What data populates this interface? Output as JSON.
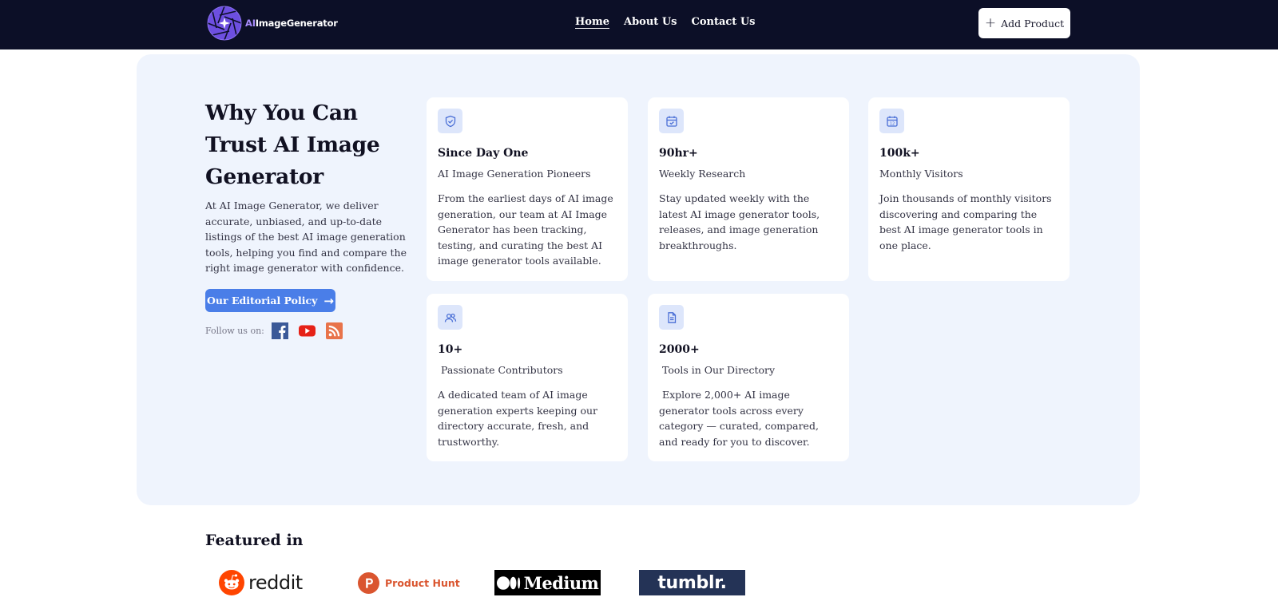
{
  "header": {
    "logo_prefix": "AI",
    "logo_suffix": "ImageGenerator",
    "nav": [
      {
        "label": "Home",
        "active": true
      },
      {
        "label": "About Us",
        "active": false
      },
      {
        "label": "Contact Us",
        "active": false
      }
    ],
    "add_product_label": "Add Product"
  },
  "trust": {
    "title": "Why You Can Trust AI Image Generator",
    "body": "At AI Image Generator, we deliver accurate, unbiased, and up-to-date listings of the best AI image generation tools, helping you find and compare the right image generator with confidence.",
    "policy_button": "Our Editorial Policy",
    "follow_label": "Follow us on:",
    "social": [
      "facebook-icon",
      "youtube-icon",
      "rss-icon"
    ],
    "cards": [
      {
        "icon": "shield-check-icon",
        "stat": "Since Day One",
        "label": "AI Image Generation Pioneers",
        "description": "From the earliest days of AI image generation, our team at AI Image Generator has been tracking, testing, and curating the best AI image generator tools available."
      },
      {
        "icon": "calendar-check-icon",
        "stat": "90hr+",
        "label": "Weekly Research",
        "description": "Stay updated weekly with the latest AI image generator tools, releases, and image generation breakthroughs."
      },
      {
        "icon": "calendar-12-icon",
        "stat": "100k+",
        "label": "Monthly Visitors",
        "description": "Join thousands of monthly visitors discovering and comparing the best AI image generator tools in one place."
      },
      {
        "icon": "users-icon",
        "stat": "10+",
        "label": " Passionate Contributors",
        "description": "A dedicated team of AI image generation experts keeping our directory accurate, fresh, and trustworthy."
      },
      {
        "icon": "document-icon",
        "stat": "2000+",
        "label": " Tools in Our Directory",
        "description": " Explore 2,000+ AI image generator tools across every category — curated, compared, and ready for you to discover."
      }
    ]
  },
  "featured": {
    "title": "Featured in",
    "brands": {
      "reddit": "reddit",
      "producthunt": "Product Hunt",
      "medium": "Medium",
      "tumblr": "tumblr."
    }
  },
  "colors": {
    "header_bg": "#0c0f27",
    "section_bg": "#eff4fd",
    "accent": "#4a7ee8",
    "icon_bg": "#dde6fb"
  }
}
